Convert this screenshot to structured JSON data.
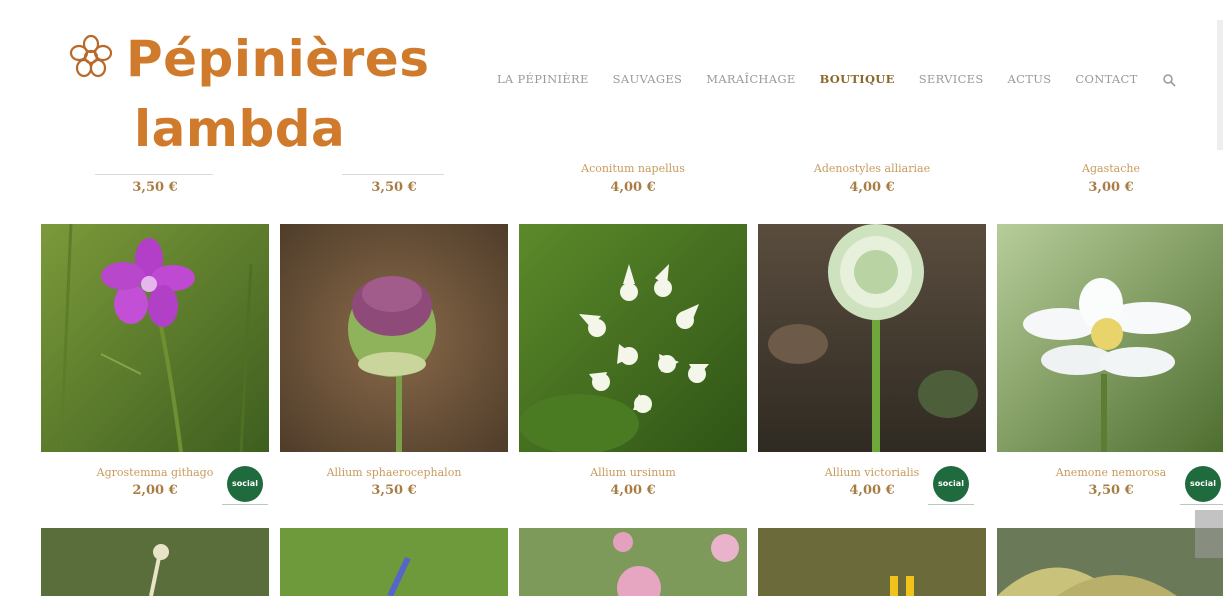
{
  "brand": {
    "line1": "Pépinières",
    "line2": "lambda",
    "icon": "flower-icon",
    "color": "#d07a2b"
  },
  "nav": {
    "items": [
      {
        "label": "LA PÉPINIÈRE",
        "active": false
      },
      {
        "label": "SAUVAGES",
        "active": false
      },
      {
        "label": "MARAÎCHAGE",
        "active": false
      },
      {
        "label": "BOUTIQUE",
        "active": true
      },
      {
        "label": "SERVICES",
        "active": false
      },
      {
        "label": "ACTUS",
        "active": false
      },
      {
        "label": "CONTACT",
        "active": false
      }
    ],
    "search_icon": "search-icon"
  },
  "top_row": [
    {
      "name": "",
      "price": "3,50 €"
    },
    {
      "name": "",
      "price": "3,50 €"
    },
    {
      "name": "Aconitum napellus",
      "price": "4,00 €"
    },
    {
      "name": "Adenostyles alliariae",
      "price": "4,00 €"
    },
    {
      "name": "Agastache",
      "price": "3,00 €"
    }
  ],
  "products": [
    {
      "name": "Agrostemma githago",
      "price": "2,00 €",
      "badge": true
    },
    {
      "name": "Allium sphaerocephalon",
      "price": "3,50 €",
      "badge": false
    },
    {
      "name": "Allium ursinum",
      "price": "4,00 €",
      "badge": false
    },
    {
      "name": "Allium victorialis",
      "price": "4,00 €",
      "badge": true
    },
    {
      "name": "Anemone nemorosa",
      "price": "3,50 €",
      "badge": true
    }
  ],
  "badge": {
    "text": "social",
    "top": "prix",
    "color": "#1f6b3e"
  },
  "colors": {
    "price": "#a87d44",
    "name": "#c79b5f",
    "nav": "#9a9a9a",
    "nav_active": "#8a6a2c"
  }
}
